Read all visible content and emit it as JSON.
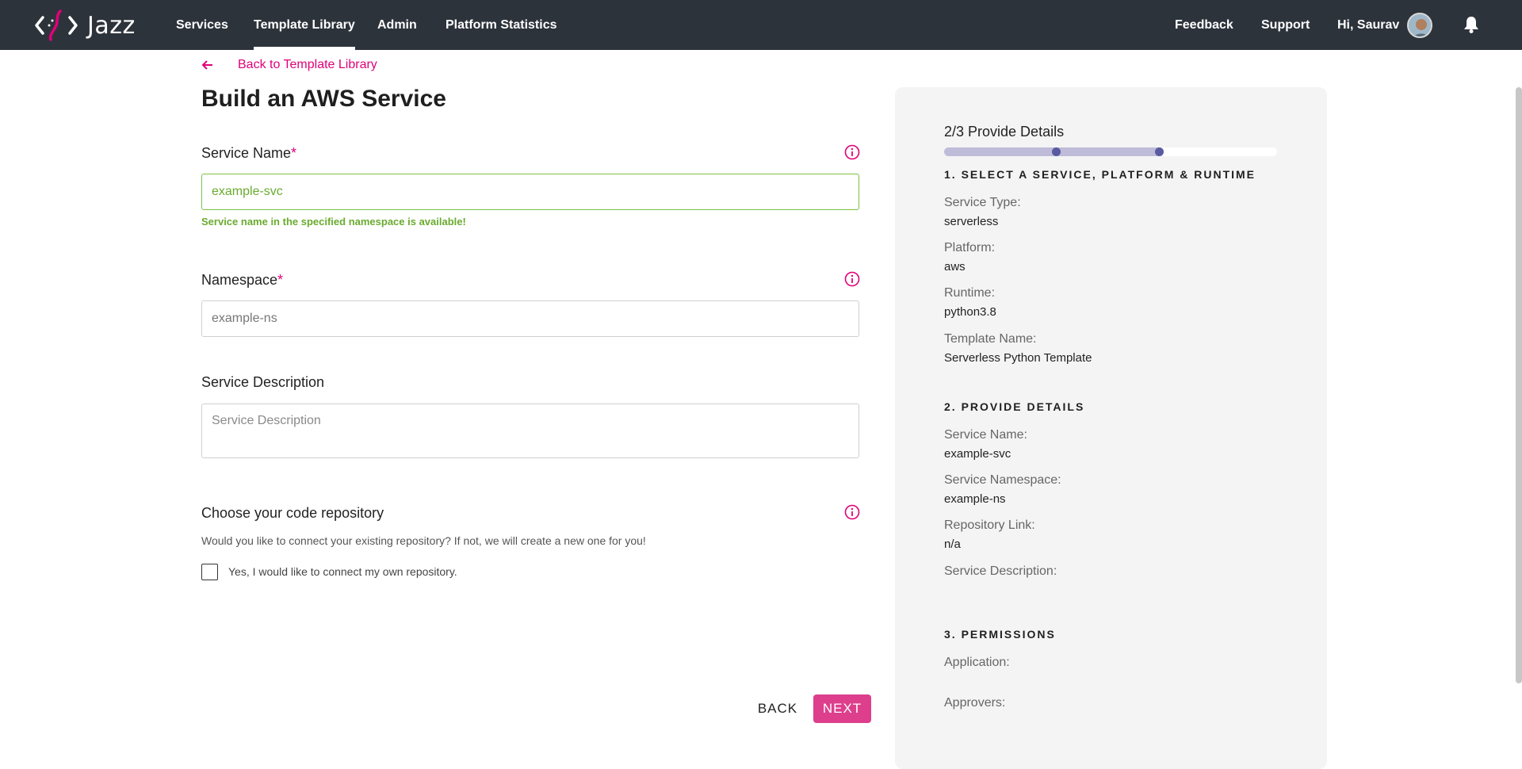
{
  "nav": {
    "logo_text": "Jazz",
    "items": [
      "Services",
      "Template Library",
      "Admin",
      "Platform Statistics"
    ],
    "active": "Template Library",
    "right": {
      "feedback": "Feedback",
      "support": "Support",
      "greeting": "Hi, Saurav"
    }
  },
  "back_link": "Back to Template Library",
  "page_title": "Build an AWS Service",
  "form": {
    "service_name": {
      "label": "Service Name",
      "required_mark": "*",
      "value": "example-svc",
      "status": "Service name in the specified namespace is available!"
    },
    "namespace": {
      "label": "Namespace",
      "required_mark": "*",
      "value": "example-ns"
    },
    "description": {
      "label": "Service Description",
      "placeholder": "Service Description"
    },
    "repository": {
      "label": "Choose your code repository",
      "description": "Would you like to connect your existing repository? If not, we will create a new one for you!",
      "checkbox_label": "Yes, I would like to connect my own repository.",
      "checked": false
    }
  },
  "buttons": {
    "back": "BACK",
    "next": "NEXT"
  },
  "summary": {
    "step": "2/3 Provide Details",
    "progress_fraction": 0.667,
    "section1": {
      "title": "1. SELECT A SERVICE, PLATFORM & RUNTIME",
      "items": [
        {
          "label": "Service Type:",
          "value": "serverless"
        },
        {
          "label": "Platform:",
          "value": "aws"
        },
        {
          "label": "Runtime:",
          "value": "python3.8"
        },
        {
          "label": "Template Name:",
          "value": "Serverless Python Template"
        }
      ]
    },
    "section2": {
      "title": "2. PROVIDE DETAILS",
      "items": [
        {
          "label": "Service Name:",
          "value": "example-svc"
        },
        {
          "label": "Service Namespace:",
          "value": "example-ns"
        },
        {
          "label": "Repository Link:",
          "value": "n/a"
        },
        {
          "label": "Service Description:",
          "value": ""
        }
      ]
    },
    "section3": {
      "title": "3. PERMISSIONS",
      "items": [
        {
          "label": "Application:",
          "value": ""
        },
        {
          "label": "Approvers:",
          "value": ""
        }
      ]
    }
  },
  "colors": {
    "accent": "#e0007a",
    "nav_bg": "#2d333b",
    "valid": "#6aab2f",
    "next_button": "#dd3f8c",
    "progress": "#5a5aa2"
  },
  "icons": [
    "jazz-logo-icon",
    "arrow-left-icon",
    "info-icon",
    "bell-icon"
  ]
}
